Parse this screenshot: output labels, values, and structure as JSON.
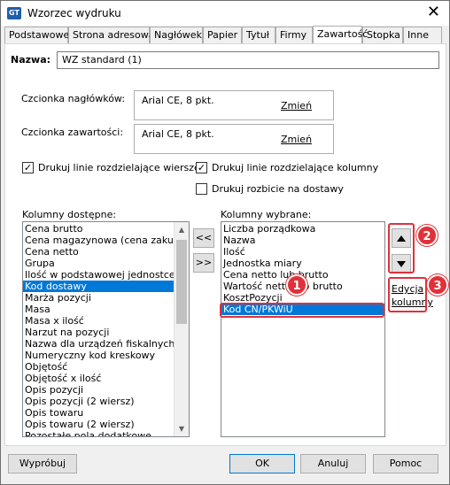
{
  "window": {
    "title": "Wzorzec wydruku",
    "icon_text": "GT",
    "close_glyph": "✕"
  },
  "tabs": [
    {
      "label": "Podstawowe"
    },
    {
      "label": "Strona adresowa"
    },
    {
      "label": "Nagłówek"
    },
    {
      "label": "Papier"
    },
    {
      "label": "Tytuł"
    },
    {
      "label": "Firmy"
    },
    {
      "label": "Zawartość"
    },
    {
      "label": "Stopka"
    },
    {
      "label": "Inne"
    }
  ],
  "active_tab": "Zawartość",
  "name_field": {
    "label": "Nazwa:",
    "value": "WZ standard (1)"
  },
  "fonts": {
    "header_label": "Czcionka nagłówków:",
    "header_value": "Arial CE, 8 pkt.",
    "header_change": "Zmień",
    "content_label": "Czcionka zawartości:",
    "content_value": "Arial CE, 8 pkt.",
    "content_change": "Zmień"
  },
  "checkboxes": {
    "row_lines": {
      "label": "Drukuj linie rozdzielające wiersze",
      "checked": true,
      "mark": "✓"
    },
    "col_lines": {
      "label": "Drukuj linie rozdzielające kolumny",
      "checked": true,
      "mark": "✓"
    },
    "delivery_split": {
      "label": "Drukuj rozbicie na dostawy",
      "checked": false,
      "mark": ""
    }
  },
  "available": {
    "label": "Kolumny dostępne:",
    "items": [
      "Cena brutto",
      "Cena magazynowa (cena zakupu)",
      "Cena netto",
      "Grupa",
      "Ilość w podstawowej jednostce miary",
      "Kod dostawy",
      "Marża pozycji",
      "Masa",
      "Masa x ilość",
      "Narzut na pozycji",
      "Nazwa dla urządzeń fiskalnych",
      "Numeryczny kod kreskowy",
      "Objętość",
      "Objętość x ilość",
      "Opis pozycji",
      "Opis pozycji (2 wiersz)",
      "Opis towaru",
      "Opis towaru (2 wiersz)",
      "Pozostałe pola dodatkowe"
    ],
    "selected_index": 5
  },
  "move_buttons": {
    "add": ">>",
    "remove": "<<"
  },
  "selected": {
    "label": "Kolumny wybrane:",
    "items": [
      "Liczba porządkowa",
      "Nazwa",
      "Ilość",
      "Jednostka miary",
      "Cena netto lub brutto",
      "Wartość netto lub brutto",
      "KosztPozycji",
      "Kod CN/PKWiU"
    ],
    "selected_index": 7
  },
  "order_buttons": {
    "up_icon": "triangle-up",
    "down_icon": "triangle-down"
  },
  "edit_link": {
    "line1": "Edycja",
    "line2": "kolumny"
  },
  "callouts": [
    "1",
    "2",
    "3"
  ],
  "footer": {
    "preview": "Wypróbuj",
    "ok": "OK",
    "cancel": "Anuluj",
    "help": "Pomoc"
  },
  "colors": {
    "selection": "#0078d7",
    "callout": "#e0313a"
  }
}
